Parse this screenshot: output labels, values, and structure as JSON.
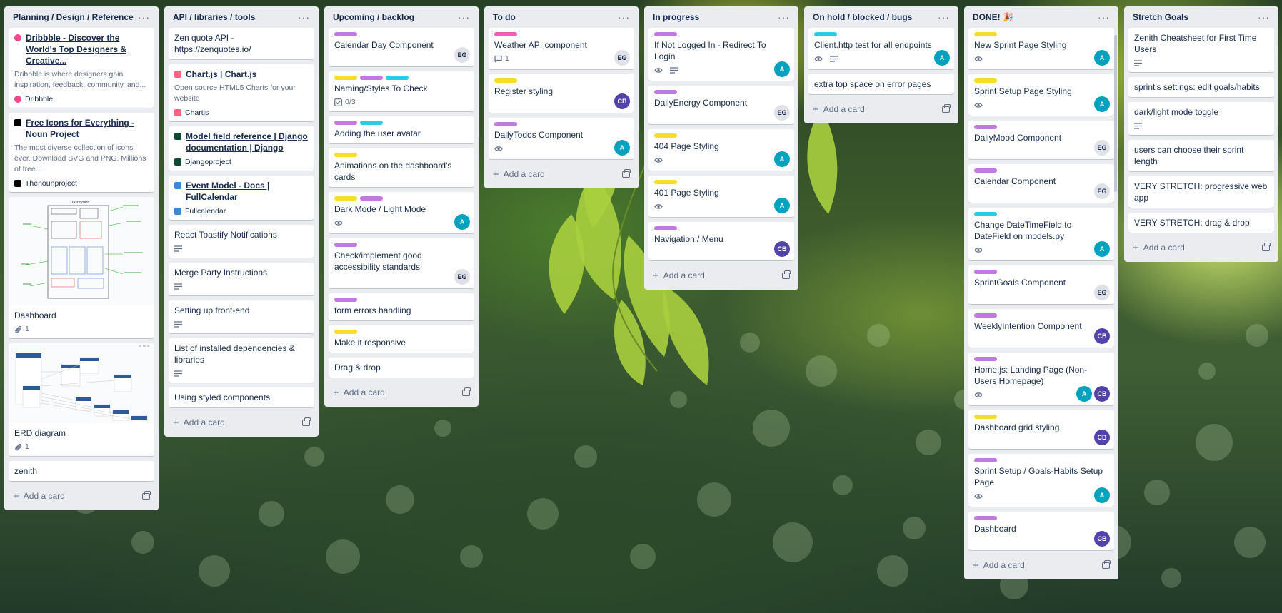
{
  "colors": {
    "pink": "#f25cb4",
    "purple": "#c377e0",
    "yellow": "#f5dd29",
    "cyan": "#29cce5",
    "teal_avatar": "#00a3bf",
    "purple_avatar": "#5243aa"
  },
  "add_card_label": "Add a card",
  "lists": [
    {
      "title": "Planning / Design / Reference",
      "cards": [
        {
          "title": "Dribbble - Discover the World's Top Designers & Creative...",
          "link": true,
          "desc": "Dribbble is where designers gain inspiration, feedback, community, and...",
          "source": "Dribbble",
          "source_icon": "dribbble-icon"
        },
        {
          "title": "Free Icons for Everything - Noun Project",
          "link": true,
          "desc": "The most diverse collection of icons ever. Download SVG and PNG. Millions of free...",
          "source": "Thenounproject",
          "source_icon": "noun-project-icon"
        },
        {
          "title": "Dashboard",
          "thumb": "dashboard",
          "attachments": "1"
        },
        {
          "title": "ERD diagram",
          "thumb": "erd",
          "attachments": "1"
        },
        {
          "title": "zenith"
        }
      ]
    },
    {
      "title": "API / libraries / tools",
      "cards": [
        {
          "title": "Zen quote API - https://zenquotes.io/"
        },
        {
          "title": "Chart.js | Chart.js",
          "link": true,
          "desc": "Open source HTML5 Charts for your website",
          "source": "Chartjs",
          "source_icon": "chartjs-icon"
        },
        {
          "title": "Model field reference | Django documentation | Django",
          "link": true,
          "source": "Djangoproject",
          "source_icon": "django-icon"
        },
        {
          "title": "Event Model - Docs | FullCalendar",
          "link": true,
          "source": "Fullcalendar",
          "source_icon": "fullcalendar-icon"
        },
        {
          "title": "React Toastify Notifications",
          "description": true
        },
        {
          "title": "Merge Party Instructions",
          "description": true
        },
        {
          "title": "Setting up front-end",
          "description": true
        },
        {
          "title": "List of installed dependencies & libraries",
          "description": true
        },
        {
          "title": "Using styled components"
        }
      ]
    },
    {
      "title": "Upcoming / backlog",
      "cards": [
        {
          "labels": [
            "purple"
          ],
          "title": "Calendar Day Component",
          "avatars": [
            "EG"
          ]
        },
        {
          "labels": [
            "yellow",
            "purple",
            "cyan"
          ],
          "title": "Naming/Styles To Check",
          "checklist": "0/3"
        },
        {
          "labels": [
            "purple",
            "cyan"
          ],
          "title": "Adding the user avatar"
        },
        {
          "labels": [
            "yellow"
          ],
          "title": "Animations on the dashboard's cards"
        },
        {
          "labels": [
            "yellow",
            "purple"
          ],
          "title": "Dark Mode / Light Mode",
          "watch": true,
          "avatars": [
            "A"
          ]
        },
        {
          "labels": [
            "purple"
          ],
          "title": "Check/implement good accessibility standards",
          "avatars": [
            "EG"
          ]
        },
        {
          "labels": [
            "purple"
          ],
          "title": "form errors handling"
        },
        {
          "labels": [
            "yellow"
          ],
          "title": "Make it responsive"
        },
        {
          "title": "Drag & drop"
        }
      ]
    },
    {
      "title": "To do",
      "cards": [
        {
          "labels": [
            "pink"
          ],
          "title": "Weather API component",
          "comments": "1",
          "avatars": [
            "EG"
          ]
        },
        {
          "labels": [
            "yellow"
          ],
          "title": "Register styling",
          "avatars": [
            "CB"
          ]
        },
        {
          "labels": [
            "purple"
          ],
          "title": "DailyTodos Component",
          "watch": true,
          "avatars": [
            "A"
          ]
        }
      ]
    },
    {
      "title": "In progress",
      "cards": [
        {
          "labels": [
            "purple"
          ],
          "title": "If Not Logged In - Redirect To Login",
          "watch": true,
          "description": true,
          "avatars": [
            "A"
          ]
        },
        {
          "labels": [
            "purple"
          ],
          "title": "DailyEnergy Component",
          "avatars": [
            "EG"
          ]
        },
        {
          "labels": [
            "yellow"
          ],
          "title": "404 Page Styling",
          "watch": true,
          "avatars": [
            "A"
          ]
        },
        {
          "labels": [
            "yellow"
          ],
          "title": "401 Page Styling",
          "watch": true,
          "avatars": [
            "A"
          ]
        },
        {
          "labels": [
            "purple"
          ],
          "title": "Navigation / Menu",
          "avatars": [
            "CB"
          ]
        }
      ]
    },
    {
      "title": "On hold / blocked / bugs",
      "cards": [
        {
          "labels": [
            "cyan"
          ],
          "title": "Client.http test for all endpoints",
          "watch": true,
          "description": true,
          "avatars": [
            "A"
          ]
        },
        {
          "title": "extra top space on error pages"
        }
      ]
    },
    {
      "title": "DONE! 🎉",
      "cards": [
        {
          "labels": [
            "yellow"
          ],
          "title": "New Sprint Page Styling",
          "watch": true,
          "avatars": [
            "A"
          ]
        },
        {
          "labels": [
            "yellow"
          ],
          "title": "Sprint Setup Page Styling",
          "watch": true,
          "avatars": [
            "A"
          ]
        },
        {
          "labels": [
            "purple"
          ],
          "title": "DailyMood Component",
          "avatars": [
            "EG"
          ]
        },
        {
          "labels": [
            "purple"
          ],
          "title": "Calendar Component",
          "avatars": [
            "EG"
          ]
        },
        {
          "labels": [
            "cyan"
          ],
          "title": "Change DateTimeField to DateField on models.py",
          "watch": true,
          "avatars": [
            "A"
          ]
        },
        {
          "labels": [
            "purple"
          ],
          "title": "SprintGoals Component",
          "avatars": [
            "EG"
          ]
        },
        {
          "labels": [
            "purple"
          ],
          "title": "WeeklyIntention Component",
          "avatars": [
            "CB"
          ]
        },
        {
          "labels": [
            "purple"
          ],
          "title": "Home.js: Landing Page (Non-Users Homepage)",
          "watch": true,
          "avatars": [
            "A",
            "CB"
          ]
        },
        {
          "labels": [
            "yellow"
          ],
          "title": "Dashboard grid styling",
          "avatars": [
            "CB"
          ]
        },
        {
          "labels": [
            "purple"
          ],
          "title": "Sprint Setup / Goals-Habits Setup Page",
          "watch": true,
          "avatars": [
            "A"
          ]
        },
        {
          "labels": [
            "purple"
          ],
          "title": "Dashboard",
          "avatars": [
            "CB"
          ]
        }
      ]
    },
    {
      "title": "Stretch Goals",
      "cards": [
        {
          "title": "Zenith Cheatsheet for First Time Users",
          "description": true
        },
        {
          "title": "sprint's settings: edit goals/habits"
        },
        {
          "title": "dark/light mode toggle",
          "description": true
        },
        {
          "title": "users can choose their sprint length"
        },
        {
          "title": "VERY STRETCH: progressive web app"
        },
        {
          "title": "VERY STRETCH: drag & drop"
        }
      ]
    }
  ]
}
